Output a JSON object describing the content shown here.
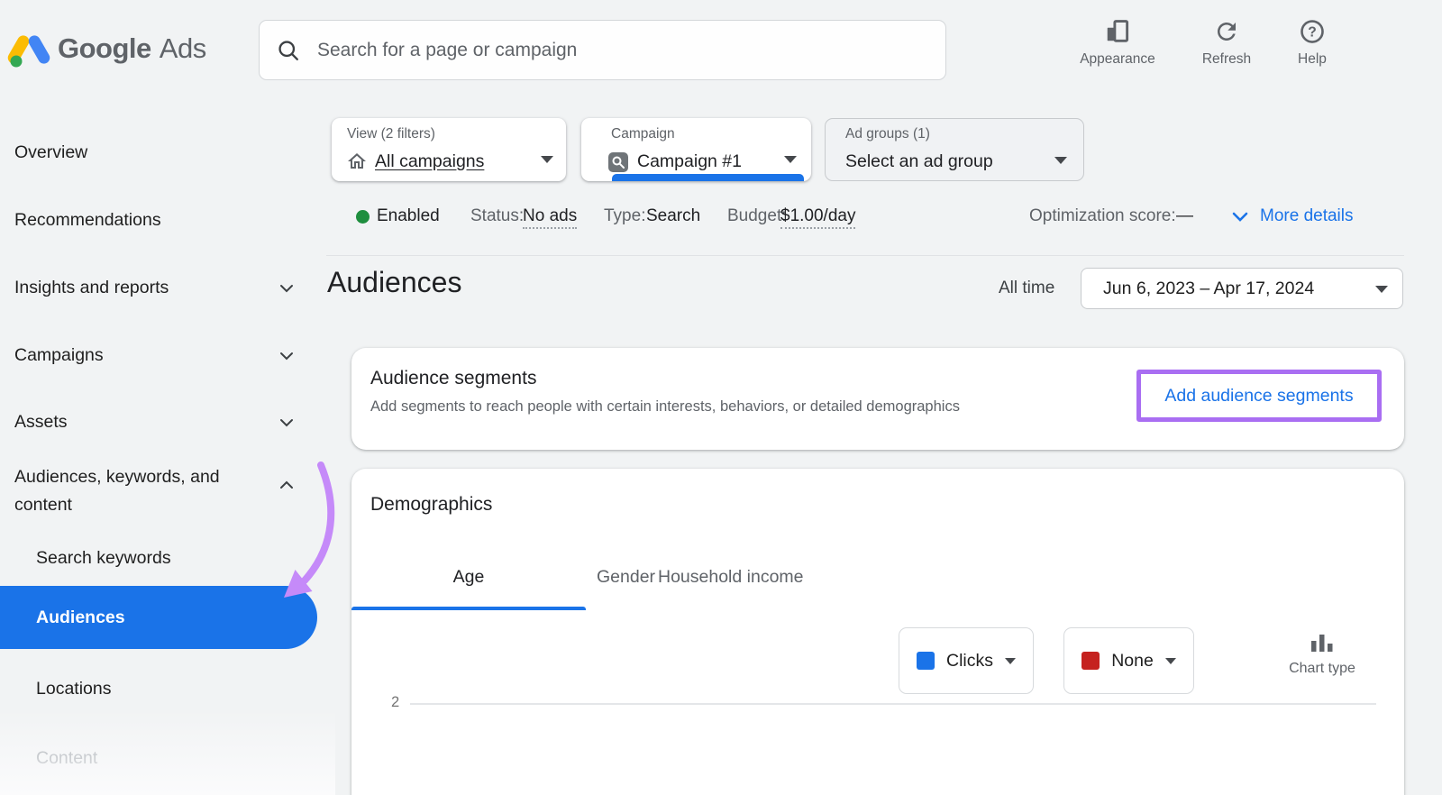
{
  "topbar": {
    "brand_word1": "Google",
    "brand_word2": "Ads",
    "search_placeholder": "Search for a page or campaign",
    "actions": [
      {
        "label": "Appearance"
      },
      {
        "label": "Refresh"
      },
      {
        "label": "Help"
      }
    ]
  },
  "sidebar": {
    "items": [
      {
        "label": "Overview"
      },
      {
        "label": "Recommendations"
      },
      {
        "label": "Insights and reports"
      },
      {
        "label": "Campaigns"
      },
      {
        "label": "Assets"
      },
      {
        "label": "Audiences, keywords, and content"
      }
    ],
    "subitems": [
      {
        "label": "Search keywords"
      },
      {
        "label": "Audiences",
        "state": "active"
      },
      {
        "label": "Locations"
      },
      {
        "label": "Content",
        "state": "muted"
      }
    ]
  },
  "filters": {
    "view_label": "View (2 filters)",
    "view_value": "All campaigns",
    "campaign_label": "Campaign",
    "campaign_value": "Campaign #1",
    "adgroup_label": "Ad groups (1)",
    "adgroup_value": "Select an ad group"
  },
  "status": {
    "enabled": "Enabled",
    "status_label": "Status:",
    "status_value": "No ads",
    "type_label": "Type:",
    "type_value": "Search",
    "budget_label": "Budget:",
    "budget_value": "$1.00/day",
    "opt_label": "Optimization score:",
    "opt_value": "—",
    "more_details": "More details"
  },
  "header": {
    "title": "Audiences",
    "date_preset": "All time",
    "date_range": "Jun 6, 2023 – Apr 17, 2024"
  },
  "segments_card": {
    "title": "Audience segments",
    "subtitle": "Add segments to reach people with certain interests, behaviors, or detailed demographics",
    "action": "Add audience segments"
  },
  "demographics_card": {
    "title": "Demographics",
    "tabs": [
      {
        "label": "Age",
        "active": true
      },
      {
        "label": "Gender"
      },
      {
        "label": "Household income"
      }
    ],
    "metric_selector": "Clicks",
    "compare_selector": "None",
    "chart_type_label": "Chart type",
    "y_tick": "2"
  },
  "colors": {
    "accent_blue": "#1a73e8",
    "metric_swatch": "#1a73e8",
    "compare_swatch": "#c5221f",
    "enabled_green": "#1e8e3e",
    "annotation_purple": "#c58af9",
    "active_nav_bg": "#1a73e8",
    "active_nav_text": "#ffffff"
  }
}
